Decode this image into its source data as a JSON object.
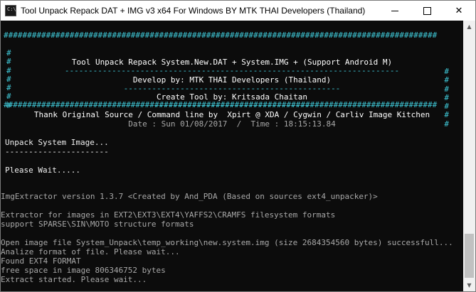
{
  "window": {
    "title": "Tool Unpack Repack DAT + IMG v3 x64 For Windows BY MTK THAI Developers (Thailand)",
    "icon_label": "C:\\",
    "controls": {
      "minimize_icon": "minimize-icon",
      "maximize_icon": "maximize-icon",
      "close_icon": "close-icon",
      "close_glyph": "✕"
    }
  },
  "banner": {
    "border": "############################################################################################",
    "hash": "#",
    "line1": "Tool Unpack Repack System.New.DAT + System.IMG + (Support Android M)",
    "dash1": "-----------------------------------------------------------------------",
    "line2": "Develop by: MTK THAI Developers (Thailand)",
    "dash2": "----------------------------------------------",
    "line3": "Create Tool by: Kritsada Chaitan",
    "dash3": "---------------------------------",
    "line4": "Thank Original Source / Command line by  Xpirt @ XDA / Cygwin / Carliv Image Kitchen"
  },
  "datetime": "Date : Sun 01/08/2017  /  Time : 18:15:13.84",
  "status": {
    "heading": "Unpack System Image...",
    "underline": "----------------------",
    "wait": "Please Wait....."
  },
  "output": [
    "ImgExtractor version 1.3.7 <Created by And_PDA (Based on sources ext4_unpacker)>",
    "Extractor for images in EXT2\\EXT3\\EXT4\\YAFFS2\\CRAMFS filesystem formats",
    "support SPARSE\\SIN\\MOTO structure formats",
    "Open image file System_Unpack\\temp_working\\new.system.img (size 2684354560 bytes) successfull...",
    "Analize format of file. Please wait...",
    "Found EXT4 FORMAT",
    "free space in image 806346752 bytes",
    "Extract started. Please wait..."
  ],
  "scrollbar": {
    "up_glyph": "▲",
    "down_glyph": "▼"
  },
  "colors": {
    "console_bg": "#0c0c0c",
    "banner_cyan": "#3fc9d8",
    "text_white": "#f0f0f0",
    "text_grey": "#a8a8a8"
  }
}
